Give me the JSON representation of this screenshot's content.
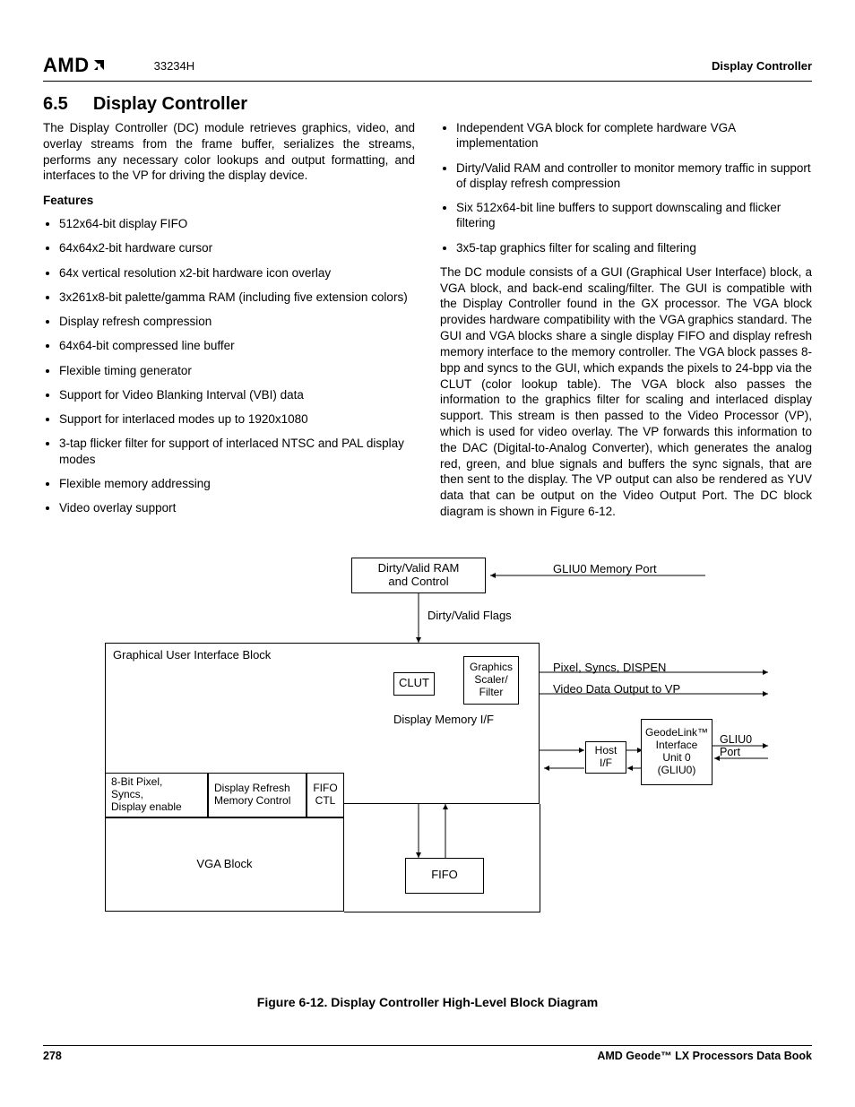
{
  "header": {
    "logo_text": "AMD",
    "doc_number": "33234H",
    "right": "Display Controller"
  },
  "section": {
    "number": "6.5",
    "title": "Display Controller"
  },
  "intro": "The Display Controller (DC) module retrieves graphics, video, and overlay streams from the frame buffer, serializes the streams, performs any necessary color lookups and output formatting, and interfaces to the VP for driving the display device.",
  "features_heading": "Features",
  "features_left": [
    "512x64-bit display FIFO",
    "64x64x2-bit hardware cursor",
    "64x vertical resolution x2-bit hardware icon overlay",
    "3x261x8-bit palette/gamma RAM (including five extension colors)",
    "Display refresh compression",
    "64x64-bit compressed line buffer",
    "Flexible timing generator",
    "Support for Video Blanking Interval (VBI) data",
    "Support for interlaced modes up to 1920x1080",
    "3-tap flicker filter for support of interlaced NTSC and PAL display modes",
    "Flexible memory addressing",
    "Video overlay support"
  ],
  "features_right": [
    "Independent VGA block for complete hardware VGA implementation",
    "Dirty/Valid RAM and controller to monitor memory traffic in support of display refresh compression",
    "Six 512x64-bit line buffers to support downscaling and flicker filtering",
    "3x5-tap graphics filter for scaling and filtering"
  ],
  "body_right": "The DC module consists of a GUI (Graphical User Interface) block, a VGA block, and back-end scaling/filter. The GUI is compatible with the Display Controller found in the GX processor. The VGA block provides hardware compatibility with the VGA graphics standard. The GUI and VGA blocks share a single display FIFO and display refresh memory interface to the memory controller. The VGA block passes 8-bpp and syncs to the GUI, which expands the pixels to 24-bpp via the CLUT (color lookup table). The VGA block also passes the information to the graphics filter for scaling and interlaced display support. This stream is then passed to the Video Processor (VP), which is used for video overlay. The VP forwards this information to the DAC (Digital-to-Analog Converter), which generates the analog red, green, and blue signals and buffers the sync signals, that are then sent to the display. The VP output can also be rendered as YUV data that can be output on the Video Output Port. The DC block diagram is shown in Figure 6-12.",
  "diagram": {
    "dirty_ram": "Dirty/Valid RAM\nand Control",
    "gliu0_mem": "GLIU0 Memory Port",
    "dirty_flags": "Dirty/Valid Flags",
    "gui_block": "Graphical User Interface Block",
    "clut": "CLUT",
    "gsf": "Graphics\nScaler/\nFilter",
    "pixel_syncs": "Pixel, Syncs, DISPEN",
    "video_out": "Video Data Output to VP",
    "dmi": "Display Memory I/F",
    "host_if": "Host I/F",
    "gliu": "GeodeLink™\nInterface\nUnit 0\n(GLIU0)",
    "gliu0_port": "GLIU0 Port",
    "eight_bit": "8-Bit Pixel,\nSyncs,\nDisplay enable",
    "drmc": "Display Refresh\nMemory Control",
    "fifo_ctl": "FIFO\nCTL",
    "fifo": "FIFO",
    "vga": "VGA Block"
  },
  "figure_caption": "Figure 6-12.  Display Controller High-Level Block Diagram",
  "footer": {
    "page": "278",
    "book": "AMD Geode™ LX Processors Data Book"
  }
}
